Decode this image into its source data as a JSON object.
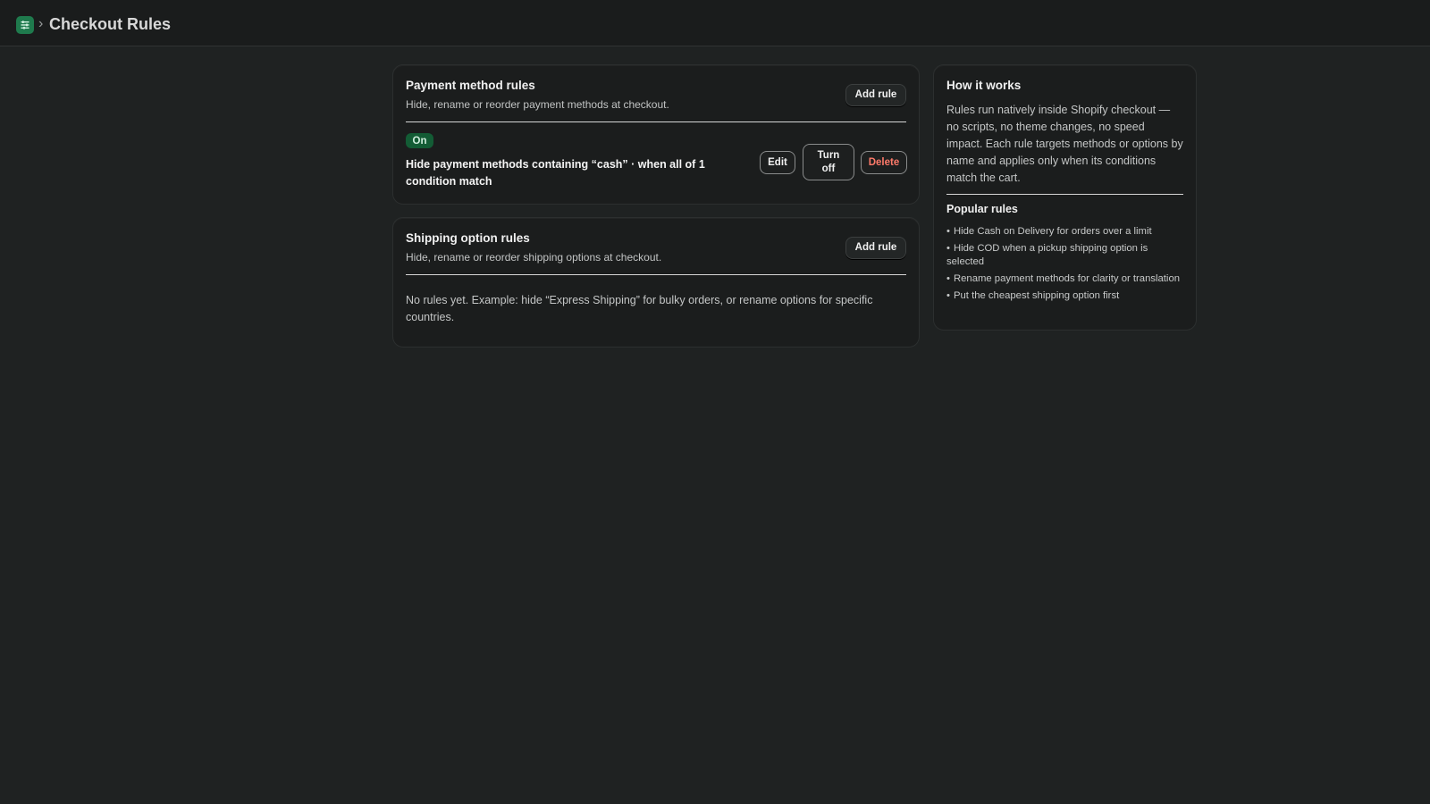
{
  "header": {
    "icon": "list-settings-icon",
    "separator": "›",
    "title": "Checkout Rules"
  },
  "payment": {
    "title": "Payment method rules",
    "subtitle": "Hide, rename or reorder payment methods at checkout.",
    "add_label": "Add rule",
    "rules": [
      {
        "status": "On",
        "description": "Hide payment methods containing “cash” · when all of 1 condition match",
        "edit_label": "Edit",
        "toggle_label": "Turn off",
        "delete_label": "Delete"
      }
    ]
  },
  "shipping": {
    "title": "Shipping option rules",
    "subtitle": "Hide, rename or reorder shipping options at checkout.",
    "add_label": "Add rule",
    "empty_text": "No rules yet. Example: hide “Express Shipping” for bulky orders, or rename options for specific countries."
  },
  "sidebar": {
    "title": "How it works",
    "description": "Rules run natively inside Shopify checkout — no scripts, no theme changes, no speed impact. Each rule targets methods or options by name and applies only when its conditions match the cart.",
    "popular_title": "Popular rules",
    "popular": [
      "Hide Cash on Delivery for orders over a limit",
      "Hide COD when a pickup shipping option is selected",
      "Rename payment methods for clarity or translation",
      "Put the cheapest shipping option first"
    ]
  },
  "colors": {
    "background": "#1f2222",
    "card": "#1b1d1d",
    "badge_on": "#135c35",
    "danger": "#ff7a6a",
    "app_icon": "#1f7a4d"
  }
}
